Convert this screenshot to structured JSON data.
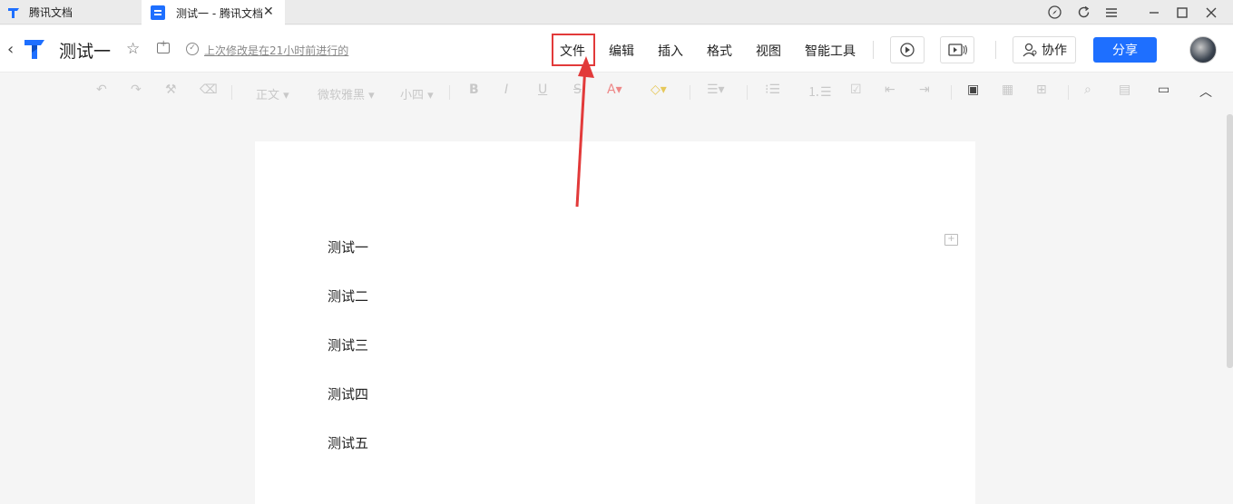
{
  "tabs": [
    {
      "label": "腾讯文档"
    },
    {
      "label": "测试一 - 腾讯文档"
    }
  ],
  "doc": {
    "title": "测试一",
    "saved_text": "上次修改是在21小时前进行的"
  },
  "menu": [
    {
      "label": "文件"
    },
    {
      "label": "编辑"
    },
    {
      "label": "插入"
    },
    {
      "label": "格式"
    },
    {
      "label": "视图"
    },
    {
      "label": "智能工具"
    }
  ],
  "header": {
    "collab_label": "协作",
    "share_label": "分享"
  },
  "toolbar": {
    "style_label": "正文",
    "font_label": "微软雅黑",
    "size_label": "小四"
  },
  "content": {
    "lines": [
      "测试一",
      "测试二",
      "测试三",
      "测试四",
      "测试五"
    ]
  },
  "colors": {
    "accent": "#1e6fff",
    "highlight_box": "#e23a3a"
  }
}
